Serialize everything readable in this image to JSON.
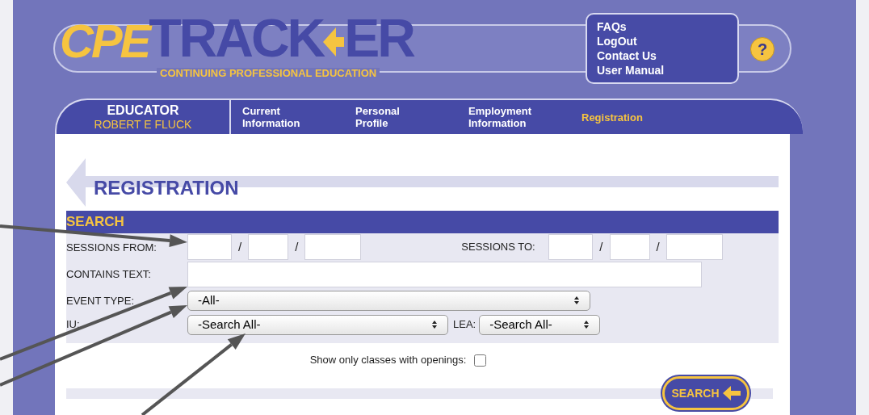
{
  "header": {
    "logo": {
      "part_1": "CPE",
      "part_2": "TRACK",
      "part_3": "ER",
      "tagline": "CONTINUING PROFESSIONAL EDUCATION"
    },
    "links": [
      "FAQs",
      "LogOut",
      "Contact Us",
      "User Manual"
    ],
    "help": "?"
  },
  "nav": {
    "role": "EDUCATOR",
    "user": "ROBERT E FLUCK",
    "tabs": [
      {
        "label": "Current\nInformation",
        "selected": false
      },
      {
        "label": "Personal\nProfile",
        "selected": false
      },
      {
        "label": "Employment\nInformation",
        "selected": false
      },
      {
        "label": "Registration",
        "selected": true
      }
    ]
  },
  "page_title": "REGISTRATION",
  "search": {
    "title": "SEARCH",
    "sessions_from": {
      "label": "SESSIONS FROM:",
      "separators": [
        "/",
        "/"
      ]
    },
    "sessions_to": {
      "label": "SESSIONS TO:",
      "separators": [
        "/",
        "/"
      ]
    },
    "contains_text": {
      "label": "CONTAINS TEXT:"
    },
    "event_type": {
      "label": "EVENT TYPE:",
      "value": "-All-"
    },
    "iu": {
      "label": "IU:",
      "value": "-Search All-"
    },
    "lea": {
      "label": "LEA:",
      "value": "-Search All-"
    },
    "openings": {
      "label": "Show only classes with openings:",
      "checked": false
    },
    "button": "SEARCH"
  }
}
